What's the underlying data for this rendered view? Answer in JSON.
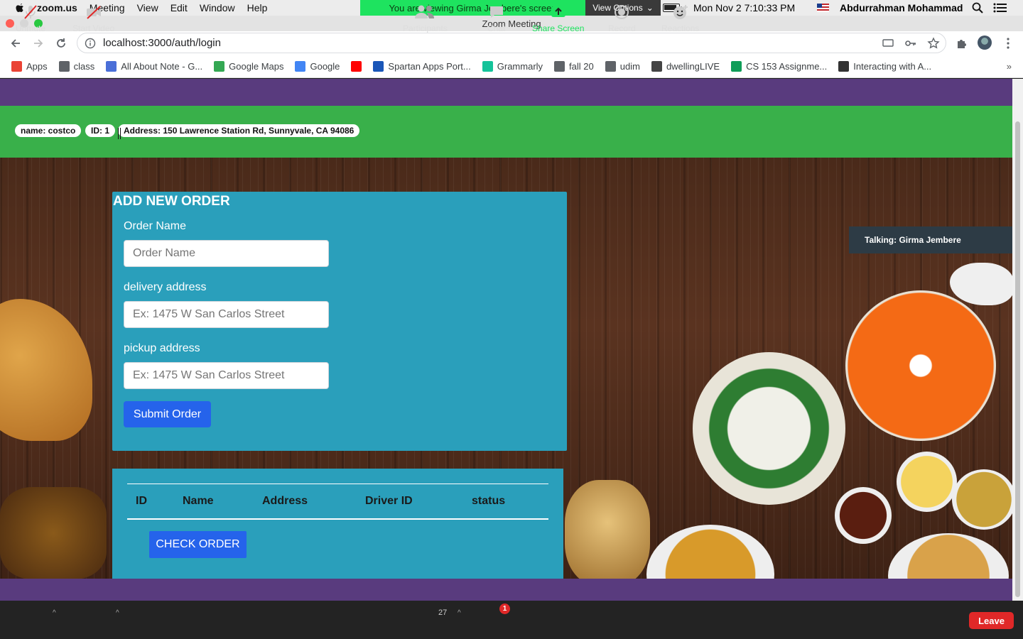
{
  "menubar": {
    "app": "zoom.us",
    "items": [
      "Meeting",
      "View",
      "Edit",
      "Window",
      "Help"
    ],
    "banner": "You are viewing Girma Jembere's screen",
    "view_options": "View Options",
    "clock": "Mon Nov 2  7:10:33 PM",
    "user": "Abdurrahman Mohammad"
  },
  "window": {
    "title": "Zoom Meeting"
  },
  "browser": {
    "url": "localhost:3000/auth/login",
    "bookmarks": [
      {
        "label": "Apps",
        "color": "#ea4335"
      },
      {
        "label": "class",
        "color": "#5f6368"
      },
      {
        "label": "All About Note - G...",
        "color": "#4a6fd8"
      },
      {
        "label": "Google Maps",
        "color": "#34a853"
      },
      {
        "label": "Google",
        "color": "#4285f4"
      },
      {
        "label": "",
        "color": "#ff0000"
      },
      {
        "label": "Spartan Apps Port...",
        "color": "#1a56b8"
      },
      {
        "label": "Grammarly",
        "color": "#15c39a"
      },
      {
        "label": "fall 20",
        "color": "#5f6368"
      },
      {
        "label": "udim",
        "color": "#5f6368"
      },
      {
        "label": "dwellingLIVE",
        "color": "#444444"
      },
      {
        "label": "CS 153 Assignme...",
        "color": "#0f9d58"
      },
      {
        "label": "Interacting with A...",
        "color": "#333333"
      }
    ]
  },
  "store": {
    "name": "name: costco",
    "id": "ID: 1",
    "address": "Address: 150 Lawrence Station Rd, Sunnyvale, CA 94086"
  },
  "form": {
    "title": "ADD NEW ORDER",
    "order_name_label": "Order Name",
    "order_name_placeholder": "Order Name",
    "delivery_label": "delivery address",
    "delivery_placeholder": "Ex: 1475 W San Carlos Street",
    "pickup_label": "pickup address",
    "pickup_placeholder": "Ex: 1475 W San Carlos Street",
    "submit": "Submit Order"
  },
  "table": {
    "headers": [
      "ID",
      "Name",
      "Address",
      "Driver ID",
      "status"
    ],
    "check_button": "CHECK ORDER"
  },
  "talking": "Talking: Girma Jembere",
  "zoom_controls": {
    "unmute": "Unmute",
    "start_video": "Start Video",
    "participants": "Participants",
    "participant_count": "27",
    "chat": "Chat",
    "chat_badge": "1",
    "share_screen": "Share Screen",
    "record": "Record",
    "reactions": "Reactions",
    "leave": "Leave"
  },
  "colors": {
    "green_bar": "#39b04a",
    "purple": "#593b7e",
    "card": "#2a9fbb",
    "button_blue": "#2563eb",
    "share_green": "#1ee35f",
    "leave_red": "#e02828"
  }
}
